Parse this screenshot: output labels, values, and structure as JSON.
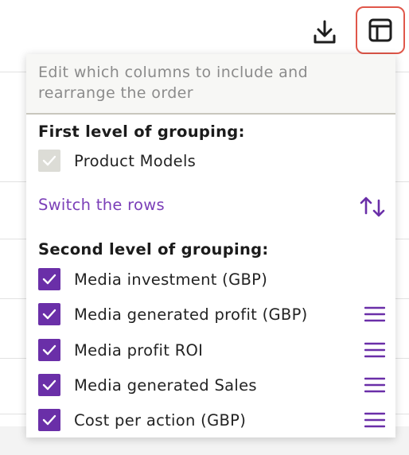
{
  "toolbar": {
    "download_icon": "download-icon",
    "columns_icon": "table-columns-icon"
  },
  "panel": {
    "instructions": "Edit which columns to include and rearrange the order",
    "first_group": {
      "title": "First level of grouping:",
      "items": [
        {
          "label": "Product Models",
          "checked": true,
          "disabled": true
        }
      ]
    },
    "switch_rows": {
      "label": "Switch the rows",
      "icon": "swap-vertical-icon"
    },
    "second_group": {
      "title": "Second level of grouping:",
      "items": [
        {
          "label": "Media investment (GBP)",
          "checked": true,
          "draggable": false
        },
        {
          "label": "Media generated profit (GBP)",
          "checked": true,
          "draggable": true
        },
        {
          "label": "Media profit ROI",
          "checked": true,
          "draggable": true
        },
        {
          "label": "Media generated Sales",
          "checked": true,
          "draggable": true
        },
        {
          "label": "Cost per action (GBP)",
          "checked": true,
          "draggable": true
        }
      ]
    }
  },
  "colors": {
    "accent": "#6a2fa8",
    "link": "#7b3fb8",
    "highlight_border": "#e0574a",
    "disabled_checkbox": "#dcdcd6"
  }
}
